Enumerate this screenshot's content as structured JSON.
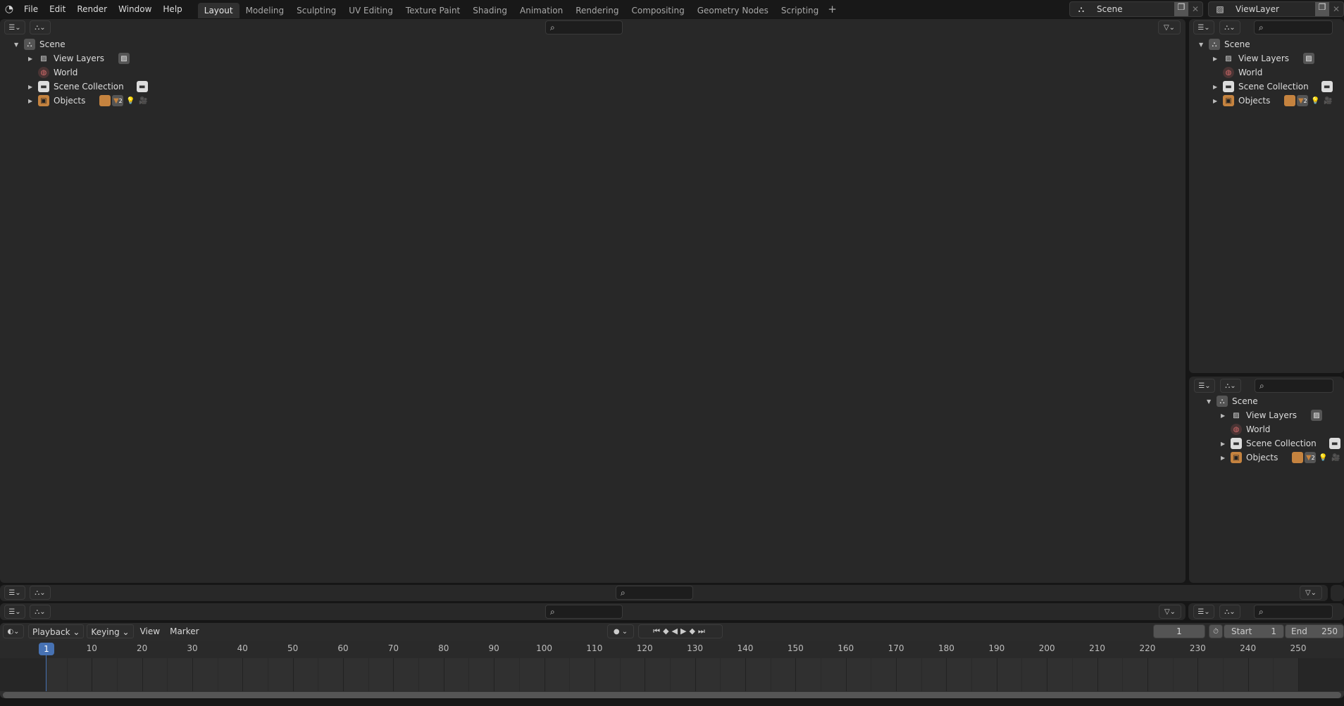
{
  "app": {
    "menus": [
      "File",
      "Edit",
      "Render",
      "Window",
      "Help"
    ],
    "workspaces": [
      "Layout",
      "Modeling",
      "Sculpting",
      "UV Editing",
      "Texture Paint",
      "Shading",
      "Animation",
      "Rendering",
      "Compositing",
      "Geometry Nodes",
      "Scripting"
    ],
    "active_workspace": "Layout",
    "add_workspace": "+",
    "scene_selector": "Scene",
    "view_layer_selector": "ViewLayer"
  },
  "outliner": {
    "items": [
      {
        "label": "Scene",
        "icon": "scene-icon",
        "expanded": true,
        "level": 0
      },
      {
        "label": "View Layers",
        "icon": "view-layers-icon",
        "level": 1
      },
      {
        "label": "World",
        "icon": "world-icon",
        "level": 1
      },
      {
        "label": "Scene Collection",
        "icon": "collection-icon",
        "level": 1
      },
      {
        "label": "Objects",
        "icon": "objects-icon",
        "level": 1
      }
    ],
    "objects_badge_count": "2"
  },
  "timeline": {
    "menus": [
      "Playback",
      "Keying",
      "View",
      "Marker"
    ],
    "current_frame": "1",
    "start_label": "Start",
    "start": "1",
    "end_label": "End",
    "end": "250",
    "ticks": [
      "10",
      "20",
      "30",
      "40",
      "50",
      "60",
      "70",
      "80",
      "90",
      "100",
      "110",
      "120",
      "130",
      "140",
      "150",
      "160",
      "170",
      "180",
      "190",
      "200",
      "210",
      "220",
      "230",
      "240",
      "250"
    ],
    "playhead_frame": "1"
  },
  "colors": {
    "accent": "#4772b3",
    "object": "#c5833f",
    "world": "#d56b6b"
  }
}
